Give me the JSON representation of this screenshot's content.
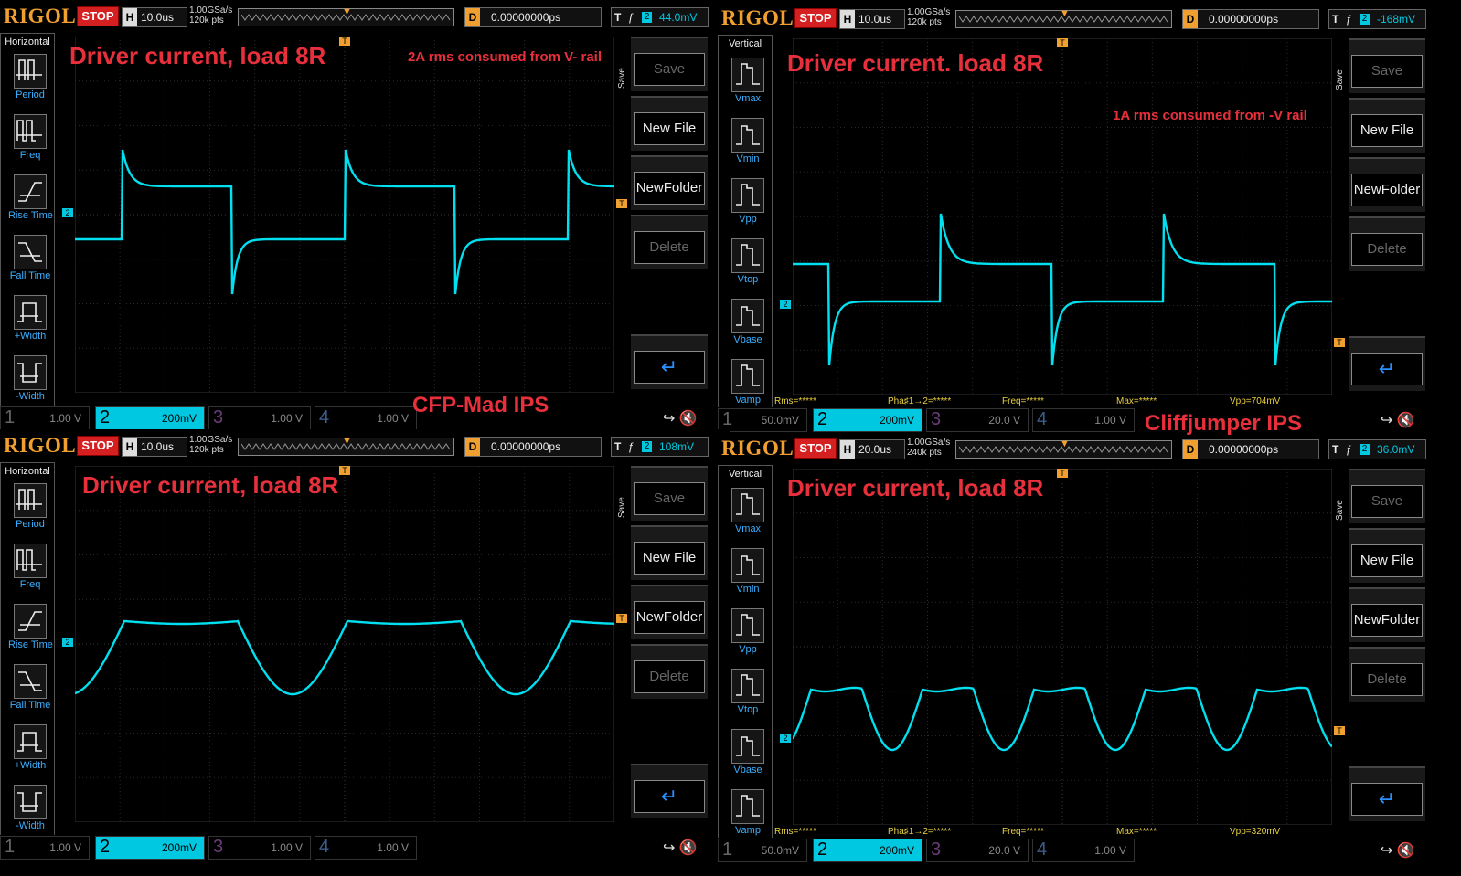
{
  "scopes": [
    {
      "logo": "RIGOL",
      "status": "STOP",
      "h_label": "H",
      "timebase": "10.0us",
      "sample_rate": "1.00GSa/s",
      "mem_depth": "120k pts",
      "d_label": "D",
      "delay": "0.00000000ps",
      "trig_label": "T",
      "trig_ch": "2",
      "trig_level": "44.0mV",
      "panel_title": "Horizontal",
      "panel_items": [
        "Period",
        "Freq",
        "Rise Time",
        "Fall Time",
        "+Width",
        "-Width"
      ],
      "save_tab": "Save",
      "buttons": [
        "Save",
        "New File",
        "NewFolder",
        "Delete"
      ],
      "ch1": {
        "num": "1",
        "val": "1.00 V"
      },
      "ch2": {
        "num": "2",
        "val": "200mV"
      },
      "ch3": {
        "num": "3",
        "val": "1.00 V"
      },
      "ch4": {
        "num": "4",
        "val": "1.00 V"
      },
      "title": "Driver current, load 8R",
      "note": "2A rms consumed from V- rail",
      "caption": "CFP-Mad IPS"
    },
    {
      "logo": "RIGOL",
      "status": "STOP",
      "h_label": "H",
      "timebase": "10.0us",
      "sample_rate": "1.00GSa/s",
      "mem_depth": "120k pts",
      "d_label": "D",
      "delay": "0.00000000ps",
      "trig_label": "T",
      "trig_ch": "2",
      "trig_level": "-168mV",
      "panel_title": "Vertical",
      "panel_items": [
        "Vmax",
        "Vmin",
        "Vpp",
        "Vtop",
        "Vbase",
        "Vamp"
      ],
      "save_tab": "Save",
      "buttons": [
        "Save",
        "New File",
        "NewFolder",
        "Delete"
      ],
      "ch1": {
        "num": "1",
        "val": "50.0mV"
      },
      "ch2": {
        "num": "2",
        "val": "200mV"
      },
      "ch3": {
        "num": "3",
        "val": "20.0 V"
      },
      "ch4": {
        "num": "4",
        "val": "1.00 V"
      },
      "measures": {
        "rms": "Rms=*****",
        "pha": "Pha♯1→2=*****",
        "freq": "Freq=*****",
        "max": "Max=*****",
        "vpp": "Vpp=704mV"
      },
      "title": "Driver current. load 8R",
      "note": "1A rms consumed from -V rail",
      "caption": "Cliffjumper IPS"
    },
    {
      "logo": "RIGOL",
      "status": "STOP",
      "h_label": "H",
      "timebase": "10.0us",
      "sample_rate": "1.00GSa/s",
      "mem_depth": "120k pts",
      "d_label": "D",
      "delay": "0.00000000ps",
      "trig_label": "T",
      "trig_ch": "2",
      "trig_level": "108mV",
      "panel_title": "Horizontal",
      "panel_items": [
        "Period",
        "Freq",
        "Rise Time",
        "Fall Time",
        "+Width",
        "-Width"
      ],
      "save_tab": "Save",
      "buttons": [
        "Save",
        "New File",
        "NewFolder",
        "Delete"
      ],
      "ch1": {
        "num": "1",
        "val": "1.00 V"
      },
      "ch2": {
        "num": "2",
        "val": "200mV"
      },
      "ch3": {
        "num": "3",
        "val": "1.00 V"
      },
      "ch4": {
        "num": "4",
        "val": "1.00 V"
      },
      "title": "Driver current, load 8R"
    },
    {
      "logo": "RIGOL",
      "status": "STOP",
      "h_label": "H",
      "timebase": "20.0us",
      "sample_rate": "1.00GSa/s",
      "mem_depth": "240k pts",
      "d_label": "D",
      "delay": "0.00000000ps",
      "trig_label": "T",
      "trig_ch": "2",
      "trig_level": "36.0mV",
      "panel_title": "Vertical",
      "panel_items": [
        "Vmax",
        "Vmin",
        "Vpp",
        "Vtop",
        "Vbase",
        "Vamp"
      ],
      "save_tab": "Save",
      "buttons": [
        "Save",
        "New File",
        "NewFolder",
        "Delete"
      ],
      "ch1": {
        "num": "1",
        "val": "50.0mV"
      },
      "ch2": {
        "num": "2",
        "val": "200mV"
      },
      "ch3": {
        "num": "3",
        "val": "20.0 V"
      },
      "ch4": {
        "num": "4",
        "val": "1.00 V"
      },
      "measures": {
        "rms": "Rms=*****",
        "pha": "Pha♯1→2=*****",
        "freq": "Freq=*****",
        "max": "Max=*****",
        "vpp": "Vpp=320mV"
      },
      "title": "Driver current, load 8R"
    }
  ],
  "icons": [
    "period-icon",
    "freq-icon",
    "rise-time-icon",
    "fall-time-icon",
    "plus-width-icon",
    "minus-width-icon",
    "return-arrow-icon",
    "usb-icon",
    "mute-icon"
  ],
  "colors": {
    "trace": "#00e0f0",
    "trigger": "#f0a030",
    "stop": "#d42020",
    "annotation": "#e8303c",
    "measure": "#e8d040"
  }
}
